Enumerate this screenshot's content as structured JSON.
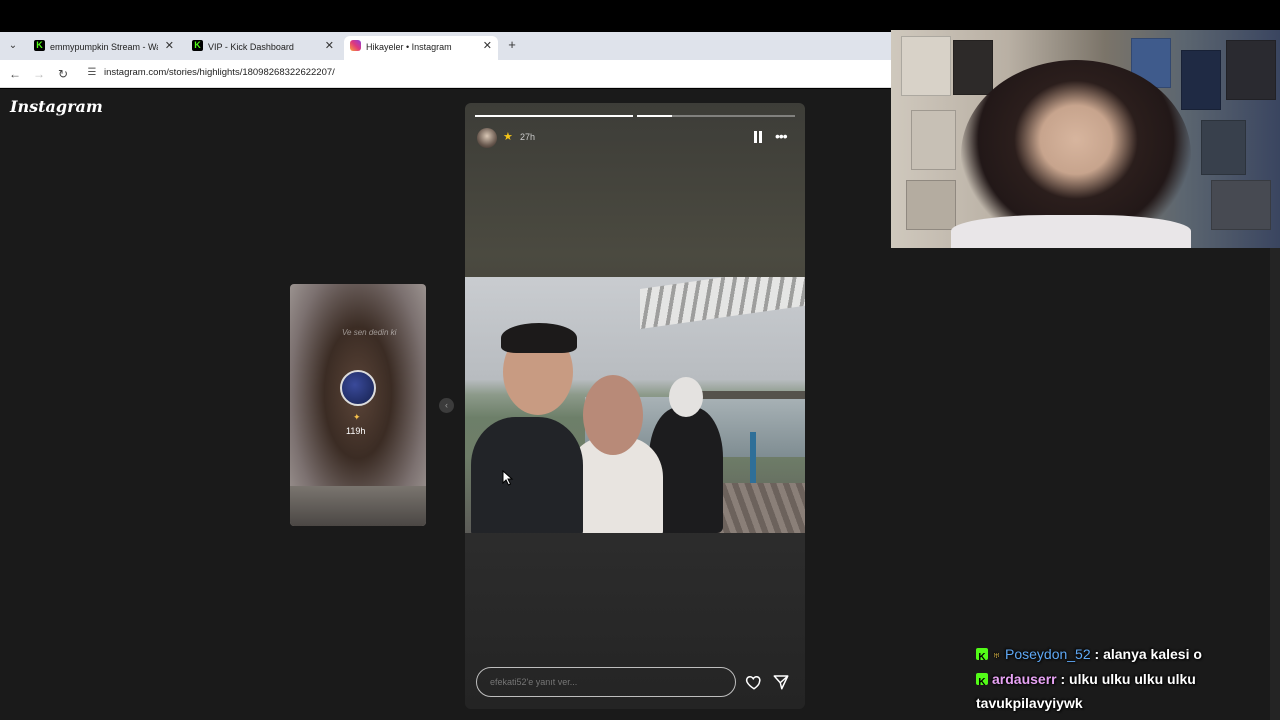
{
  "browser": {
    "tabs": [
      {
        "title": "emmypumpkin Stream - Watch",
        "favicon": "kick-icon",
        "active": false
      },
      {
        "title": "VIP - Kick Dashboard",
        "favicon": "kick-icon",
        "active": false
      },
      {
        "title": "Hikayeler • Instagram",
        "favicon": "instagram-icon",
        "active": true
      }
    ],
    "url": "instagram.com/stories/highlights/18098268322622207/"
  },
  "instagram": {
    "logo": "Instagram",
    "prev_story": {
      "overlay_text": "Ve sen dedin ki",
      "time": "119h"
    },
    "story": {
      "time": "27h",
      "progress_segments": [
        {
          "fill": 1.0
        },
        {
          "fill": 0.22
        }
      ],
      "reply_placeholder": "efekati52'e yanıt ver..."
    }
  },
  "chat": {
    "messages": [
      {
        "username": "Poseydon_52",
        "text": ": alanya kalesi o",
        "badges": [
          "kick-icon",
          "sub-icon"
        ],
        "color": "#5fa8f5"
      },
      {
        "username": "ardauserr",
        "text": ": ulku ulku ulku ulku tavukpilavyiywk",
        "badges": [
          "kick-icon"
        ],
        "color": "#e7a3f4"
      }
    ]
  }
}
